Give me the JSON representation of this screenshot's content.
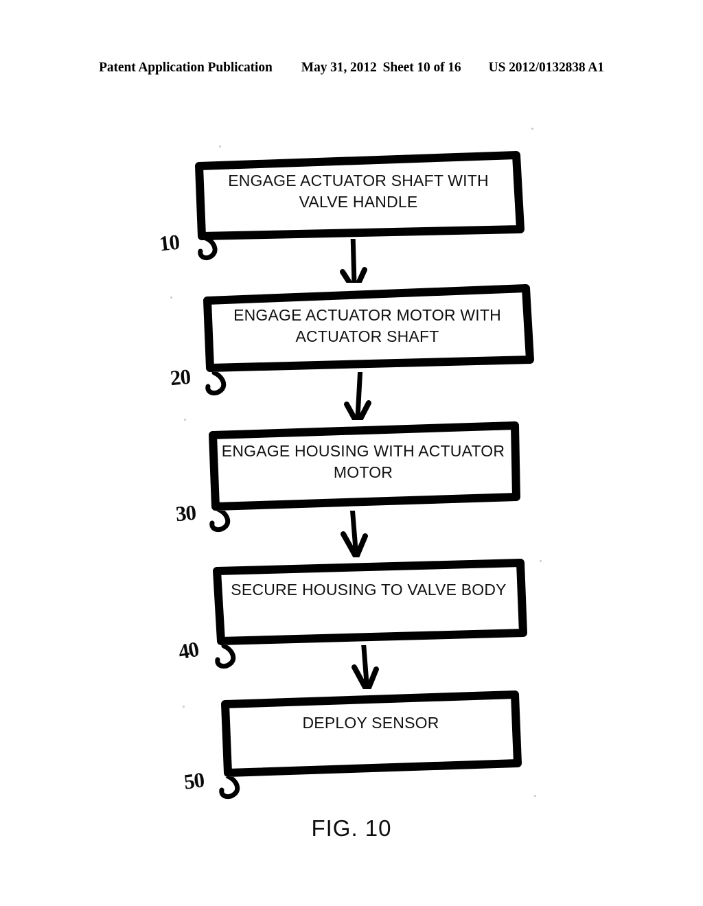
{
  "page": {
    "header": {
      "publication": "Patent Application Publication",
      "date": "May 31, 2012",
      "sheet": "Sheet 10 of 16",
      "doc_number": "US 2012/0132838 A1"
    },
    "figure_caption": "FIG. 10",
    "background_color": "#ffffff",
    "ink_color": "#000000"
  },
  "flowchart": {
    "title": "FIG. 10",
    "orientation": "vertical",
    "style": "hand-drawn",
    "steps": [
      {
        "ref": "10",
        "text": "ENGAGE ACTUATOR SHAFT WITH\nVALVE HANDLE"
      },
      {
        "ref": "20",
        "text": "ENGAGE ACTUATOR MOTOR WITH\nACTUATOR SHAFT"
      },
      {
        "ref": "30",
        "text": "ENGAGE HOUSING WITH ACTUATOR\nMOTOR"
      },
      {
        "ref": "40",
        "text": "SECURE HOUSING TO VALVE BODY"
      },
      {
        "ref": "50",
        "text": "DEPLOY SENSOR"
      }
    ],
    "connectors": [
      {
        "from_ref": "10",
        "to_ref": "20",
        "type": "arrow-down"
      },
      {
        "from_ref": "20",
        "to_ref": "30",
        "type": "arrow-down"
      },
      {
        "from_ref": "30",
        "to_ref": "40",
        "type": "arrow-down"
      },
      {
        "from_ref": "40",
        "to_ref": "50",
        "type": "arrow-down"
      }
    ]
  }
}
